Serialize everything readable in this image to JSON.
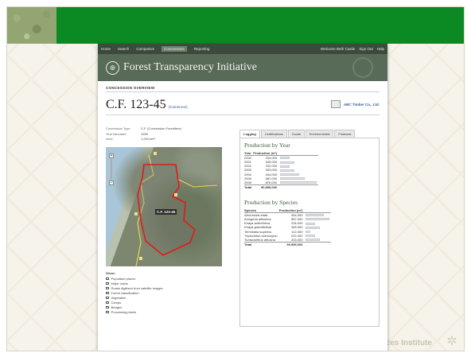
{
  "nav": {
    "items": [
      "Home",
      "Search",
      "Companies",
      "Concessions",
      "Reporting"
    ],
    "active_index": 3,
    "welcome": "Welcome Beth Castle",
    "signout": "Sign Out",
    "help": "Help"
  },
  "header": {
    "title": "Forest Transparency Initiative",
    "logo_glyph": "⊛"
  },
  "section_label": "CONCESSION OVERVIEW",
  "concession": {
    "id": "C.F. 123-45",
    "country": "(Cameroon)",
    "company": "ABC Timber Co., Ltd."
  },
  "meta": [
    {
      "label": "Concession Type",
      "value": "C.F. (Concession Forestière)"
    },
    {
      "label": "Year Allocated",
      "value": "1999"
    },
    {
      "label": "Area",
      "value": "1,234 km²"
    }
  ],
  "map": {
    "label": "C.F. 123-45"
  },
  "show": {
    "heading": "Show:",
    "options": [
      "Populated places",
      "Major roads",
      "Roads digitized from satellite images",
      "Forest classification",
      "Vegetation",
      "Camps",
      "Bridges",
      "Processing plants"
    ]
  },
  "tabs": [
    "Logging",
    "Certifications",
    "Social",
    "Environmental",
    "Financial"
  ],
  "active_tab": 0,
  "by_year": {
    "heading": "Production by Year",
    "col1": "Year",
    "col2": "Production (m³)",
    "rows": [
      {
        "label": "2000",
        "value": "234,000",
        "fraction": 0.27
      },
      {
        "label": "2001",
        "value": "345,000",
        "fraction": 0.4
      },
      {
        "label": "2002",
        "value": "232,000",
        "fraction": 0.27
      },
      {
        "label": "2003",
        "value": "333,000",
        "fraction": 0.38
      },
      {
        "label": "2004",
        "value": "444,000",
        "fraction": 0.51
      },
      {
        "label": "2005",
        "value": "587,000",
        "fraction": 0.67
      },
      {
        "label": "2006",
        "value": "876,000",
        "fraction": 1.0
      }
    ],
    "total_label": "Total",
    "total_value": "90,999,000"
  },
  "by_species": {
    "heading": "Production by Species",
    "col1": "Species",
    "col2": "Production (m³)",
    "rows": [
      {
        "label": "Afrormosia elata",
        "value": "444,000",
        "fraction": 0.76
      },
      {
        "label": "Aningeria altissima",
        "value": "587,000",
        "fraction": 1.0
      },
      {
        "label": "Khaya anthotheca",
        "value": "234,000",
        "fraction": 0.4
      },
      {
        "label": "Khaya grandifoliola",
        "value": "345,000",
        "fraction": 0.59
      },
      {
        "label": "Terminalia superba",
        "value": "112,000",
        "fraction": 0.19
      },
      {
        "label": "Triplochiton scleroxylon",
        "value": "222,000",
        "fraction": 0.38
      },
      {
        "label": "Turraeanthus africana",
        "value": "333,000",
        "fraction": 0.57
      }
    ],
    "total_label": "Total",
    "total_value": "90,999,000"
  },
  "watermark": "ources Institute",
  "colors": {
    "topbar": "#0b8a23",
    "nav": "#3b4a3b",
    "banner": "#586a58",
    "polygon": "#e01b1b"
  }
}
